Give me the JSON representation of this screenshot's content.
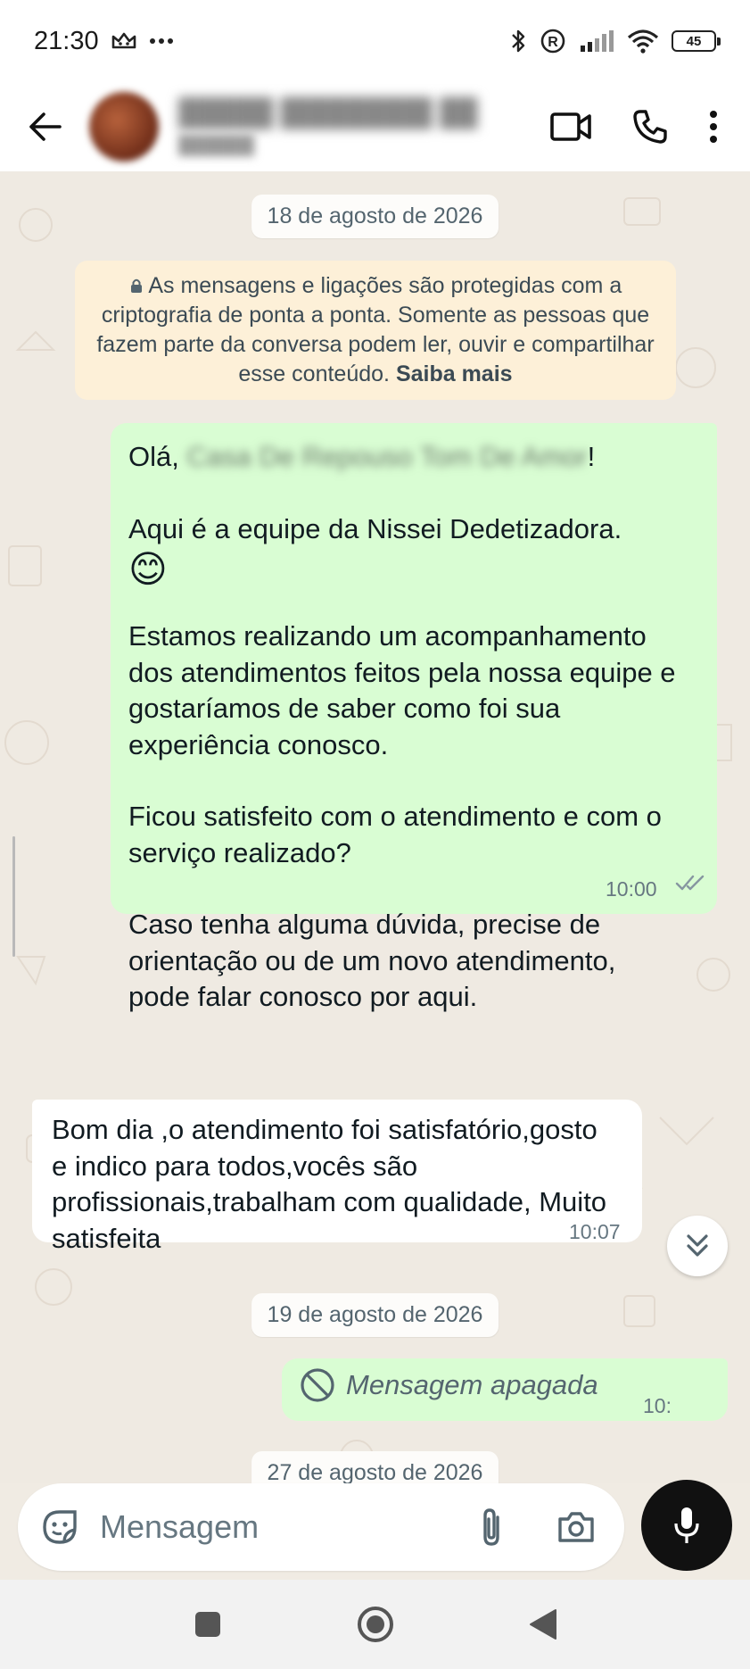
{
  "status_bar": {
    "time": "21:30",
    "battery": "45",
    "icons": [
      "crown-icon",
      "more-dots-icon",
      "bluetooth-icon",
      "registered-icon",
      "signal-icon",
      "wifi-icon",
      "battery-icon"
    ]
  },
  "header": {
    "icons": [
      "back-arrow-icon",
      "video-call-icon",
      "phone-icon",
      "kebab-menu-icon"
    ]
  },
  "chat": {
    "date_1": "18 de agosto de 2026",
    "encryption_text": "As mensagens e ligações são protegidas com a criptografia de ponta a ponta. Somente as pessoas que fazem parte da conversa podem ler, ouvir e compartilhar esse conteúdo.",
    "encryption_link": "Saiba mais",
    "msg1": {
      "greeting": "Olá,",
      "exclamation": "!",
      "line_team": "Aqui é a equipe da Nissei Dedetizadora.",
      "emoji": "😊",
      "para_followup": "Estamos realizando um acompanhamento dos atendimentos feitos pela nossa equipe e gostaríamos de saber como foi sua experiência conosco.",
      "para_question": "Ficou satisfeito com o atendimento e com o serviço realizado?",
      "para_help": "Caso tenha alguma dúvida, precise de orientação ou de um novo atendimento, pode falar conosco por aqui.",
      "time": "10:00"
    },
    "msg2": {
      "text": "Bom dia ,o atendimento foi satisfatório,gosto e indico para todos,vocês são profissionais,trabalham com qualidade, Muito satisfeita",
      "time": "10:07"
    },
    "date_2": "19 de agosto de 2026",
    "msg3": {
      "text": "Mensagem apagada",
      "time": "10:"
    },
    "date_3": "27 de agosto de 2026"
  },
  "input": {
    "placeholder": "Mensagem",
    "icons": [
      "sticker-icon",
      "attach-icon",
      "camera-icon",
      "mic-icon"
    ]
  },
  "nav": {
    "icons": [
      "recents-icon",
      "home-icon",
      "back-icon"
    ]
  },
  "colors": {
    "outgoing_bubble": "#d9fdd3",
    "incoming_bubble": "#ffffff",
    "chat_background": "#efeae2",
    "encryption_notice": "#fdf0d8",
    "mic_button": "#111111"
  }
}
